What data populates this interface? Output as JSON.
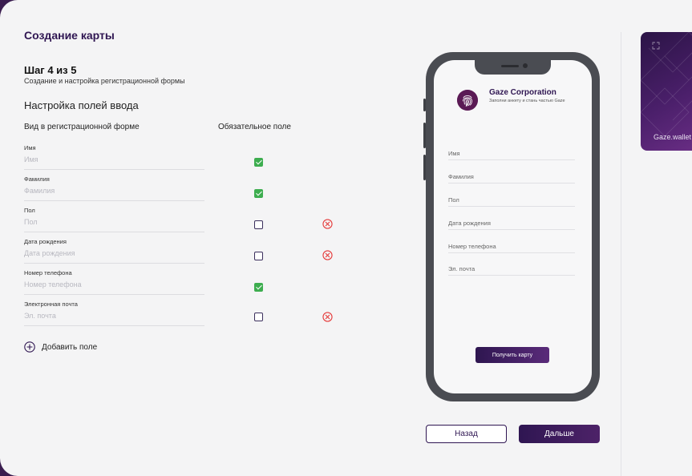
{
  "page": {
    "title": "Создание карты"
  },
  "step": {
    "title": "Шаг 4 из 5",
    "subtitle": "Создание и настройка регистрационной формы"
  },
  "section": {
    "title": "Настройка полей ввода",
    "col_view": "Вид в регистрационной форме",
    "col_required": "Обязательное поле"
  },
  "fields": [
    {
      "label": "Имя",
      "placeholder": "Имя",
      "required": true,
      "deletable": false
    },
    {
      "label": "Фамилия",
      "placeholder": "Фамилия",
      "required": true,
      "deletable": false
    },
    {
      "label": "Пол",
      "placeholder": "Пол",
      "required": false,
      "deletable": true
    },
    {
      "label": "Дата рождения",
      "placeholder": "Дата рождения",
      "required": false,
      "deletable": true
    },
    {
      "label": "Номер телефона",
      "placeholder": "Номер телефона",
      "required": true,
      "deletable": false
    },
    {
      "label": "Электронная почта",
      "placeholder": "Эл. почта",
      "required": false,
      "deletable": true
    }
  ],
  "add_field_label": "Добавить поле",
  "preview": {
    "company": "Gaze Corporation",
    "slogan": "Заполни анкету и стань частью Gaze",
    "fields": [
      "Имя",
      "Фамилия",
      "Пол",
      "Дата рождения",
      "Номер телефона",
      "Эл. почта"
    ],
    "button": "Получить карту"
  },
  "nav": {
    "back": "Назад",
    "next": "Дальше"
  },
  "card_thumb": {
    "name": "Gaze.wallet"
  },
  "colors": {
    "accent": "#2f1652",
    "check": "#3dad4f",
    "delete": "#e53b3b",
    "logo": "#5b1a55"
  }
}
